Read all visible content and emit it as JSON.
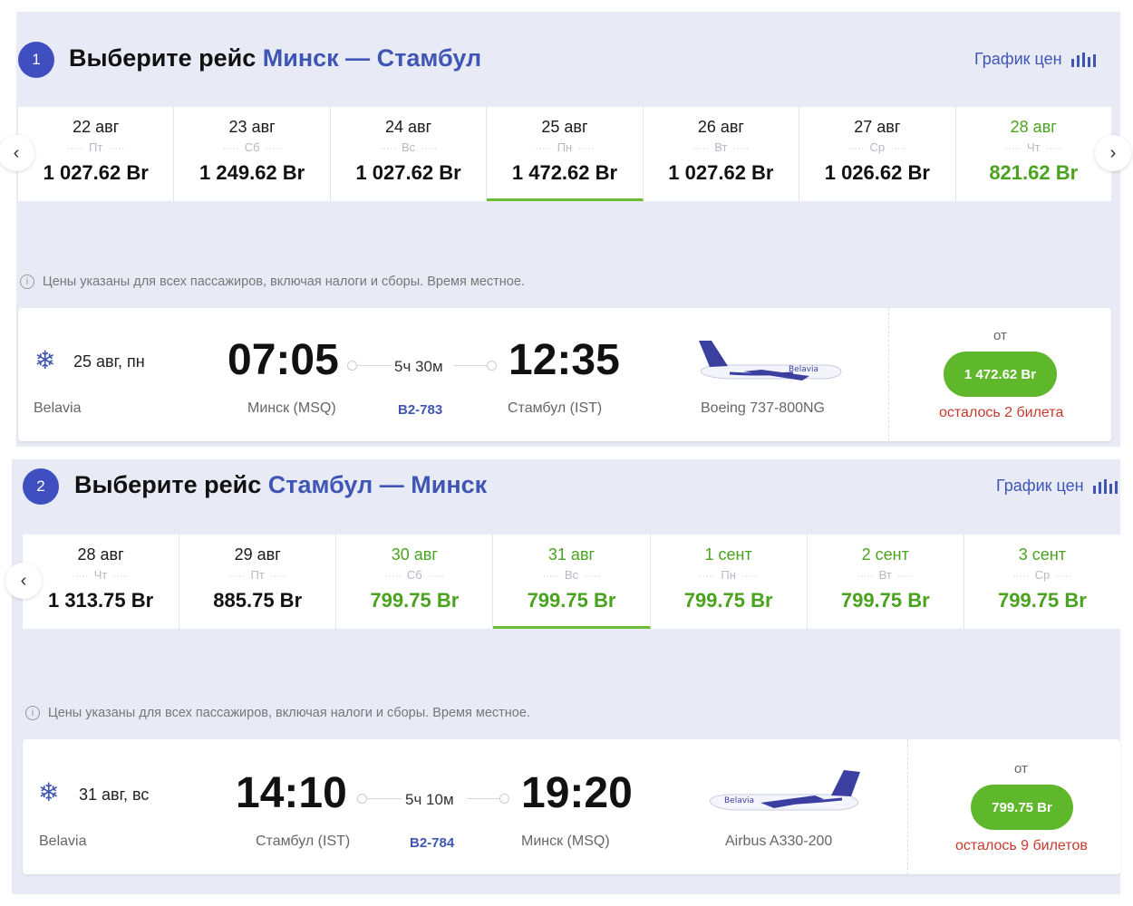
{
  "sections": [
    {
      "step": "1",
      "title_prefix": "Выберите рейс",
      "route": "Минск — Стамбул",
      "price_chart_label": "График цен",
      "dates": [
        {
          "date": "22 авг",
          "weekday": "Пт",
          "price": "1 027.62 Br"
        },
        {
          "date": "23 авг",
          "weekday": "Сб",
          "price": "1 249.62 Br"
        },
        {
          "date": "24 авг",
          "weekday": "Вс",
          "price": "1 027.62 Br"
        },
        {
          "date": "25 авг",
          "weekday": "Пн",
          "price": "1 472.62 Br"
        },
        {
          "date": "26 авг",
          "weekday": "Вт",
          "price": "1 027.62 Br"
        },
        {
          "date": "27 авг",
          "weekday": "Ср",
          "price": "1 026.62 Br"
        },
        {
          "date": "28 авг",
          "weekday": "Чт",
          "price": "821.62 Br"
        }
      ],
      "selected_date_index": 3,
      "note": "Цены указаны для всех пассажиров, включая налоги и сборы. Время местное.",
      "flight": {
        "date": "25 авг, пн",
        "airline": "Belavia",
        "departure_time": "07:05",
        "arrival_time": "12:35",
        "duration": "5ч 30м",
        "from_city": "Минск (MSQ)",
        "to_city": "Стамбул (IST)",
        "flight_number": "B2-783",
        "aircraft": "Boeing 737-800NG",
        "plane_logo": "Belavia",
        "price_prefix": "от",
        "price": "1 472.62 Br",
        "seats_left": "осталось 2 билета"
      }
    },
    {
      "step": "2",
      "title_prefix": "Выберите рейс",
      "route": "Стамбул — Минск",
      "price_chart_label": "График цен",
      "dates": [
        {
          "date": "28 авг",
          "weekday": "Чт",
          "price": "1 313.75 Br"
        },
        {
          "date": "29 авг",
          "weekday": "Пт",
          "price": "885.75 Br"
        },
        {
          "date": "30 авг",
          "weekday": "Сб",
          "price": "799.75 Br"
        },
        {
          "date": "31 авг",
          "weekday": "Вс",
          "price": "799.75 Br"
        },
        {
          "date": "1 сент",
          "weekday": "Пн",
          "price": "799.75 Br"
        },
        {
          "date": "2 сент",
          "weekday": "Вт",
          "price": "799.75 Br"
        },
        {
          "date": "3 сент",
          "weekday": "Ср",
          "price": "799.75 Br"
        }
      ],
      "selected_date_index": 3,
      "note": "Цены указаны для всех пассажиров, включая налоги и сборы. Время местное.",
      "flight": {
        "date": "31 авг, вс",
        "airline": "Belavia",
        "departure_time": "14:10",
        "arrival_time": "19:20",
        "duration": "5ч 10м",
        "from_city": "Стамбул (IST)",
        "to_city": "Минск (MSQ)",
        "flight_number": "B2-784",
        "aircraft": "Airbus A330-200",
        "plane_logo": "Belavia",
        "price_prefix": "от",
        "price": "799.75 Br",
        "seats_left": "осталось 9 билетов"
      }
    }
  ],
  "colors": {
    "accent": "#3f56b5",
    "cheap_price": "#4aa31e",
    "buy_button": "#5fb82c",
    "warning": "#c63a2e",
    "section_bg": "#e8ebf6"
  },
  "icons": [
    "info-icon",
    "snowflake-logo-icon",
    "chevron-left-icon",
    "chevron-right-icon",
    "bar-chart-icon",
    "airplane-image"
  ]
}
